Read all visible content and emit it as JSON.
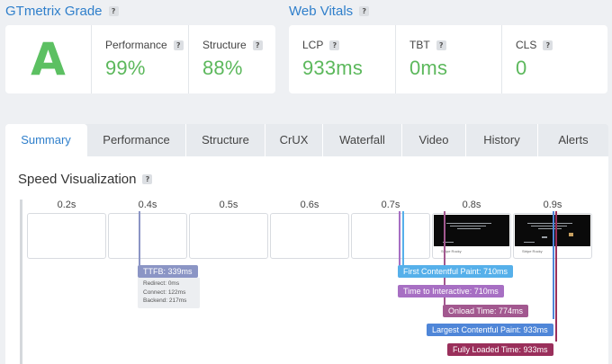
{
  "gtmetrix_grade": {
    "title": "GTmetrix Grade",
    "grade": "A",
    "performance_label": "Performance",
    "performance_value": "99%",
    "structure_label": "Structure",
    "structure_value": "88%"
  },
  "web_vitals": {
    "title": "Web Vitals",
    "lcp_label": "LCP",
    "lcp_value": "933ms",
    "tbt_label": "TBT",
    "tbt_value": "0ms",
    "cls_label": "CLS",
    "cls_value": "0"
  },
  "help_glyph": "?",
  "tabs": [
    "Summary",
    "Performance",
    "Structure",
    "CrUX",
    "Waterfall",
    "Video",
    "History",
    "Alerts"
  ],
  "active_tab": "Summary",
  "speed_visualization": {
    "title": "Speed Visualization",
    "time_labels": [
      "0.2s",
      "0.4s",
      "0.5s",
      "0.6s",
      "0.7s",
      "0.8s",
      "0.9s"
    ],
    "filmstrip_caption": "Stripe Rocky",
    "ttfb_label": "TTFB: 339ms",
    "ttfb_breakdown": [
      "Redirect: 0ms",
      "Connect: 122ms",
      "Backend: 217ms"
    ],
    "markers": [
      {
        "label": "First Contentful Paint: 710ms",
        "color": "#56b0ea"
      },
      {
        "label": "Time to Interactive: 710ms",
        "color": "#a76fc3"
      },
      {
        "label": "Onload Time: 774ms",
        "color": "#a2588f"
      },
      {
        "label": "Largest Contentful Paint: 933ms",
        "color": "#4f86d8"
      },
      {
        "label": "Fully Loaded Time: 933ms",
        "color": "#9a2f5b"
      }
    ]
  },
  "colors": {
    "accent": "#2f7fcb",
    "grade_green": "#5cc062",
    "ttfb": "#8b95c5"
  }
}
